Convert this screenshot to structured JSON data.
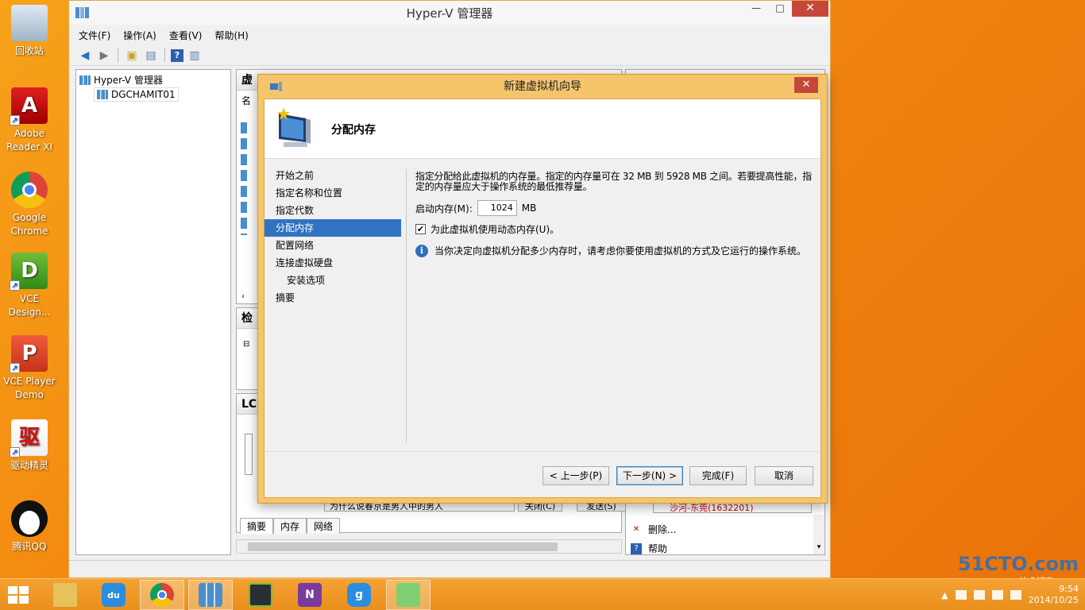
{
  "desktop": {
    "icons": [
      {
        "label": "回收站"
      },
      {
        "label": "Adobe Reader XI"
      },
      {
        "label": "Google Chrome"
      },
      {
        "label": "VCE Design..."
      },
      {
        "label": "VCE Player Demo"
      },
      {
        "label": "驱动精灵"
      },
      {
        "label": "腾讯QQ"
      }
    ]
  },
  "main_window": {
    "title": "Hyper-V 管理器",
    "controls": {
      "minimize": "—",
      "maximize": "□",
      "close": "✕"
    },
    "menu": [
      "文件(F)",
      "操作(A)",
      "查看(V)",
      "帮助(H)"
    ],
    "tree": {
      "root": "Hyper-V 管理器",
      "server": "DGCHAMIT01"
    },
    "center": {
      "vm_header": "虚",
      "name_col": "名",
      "checkpoint_header": "检",
      "details_header": "LC",
      "tabs": [
        "摘要",
        "内存",
        "网络"
      ]
    },
    "actions": {
      "header": "操",
      "delete": "删除...",
      "help": "帮助"
    },
    "background_text": {
      "chat_line": "为什么说春京是男人中的男人",
      "close_btn": "关闭(C)",
      "send_btn": "发送(S)",
      "contact": "沙河-东莞(1632201)"
    }
  },
  "wizard": {
    "title": "新建虚拟机向导",
    "close": "✕",
    "page_title": "分配内存",
    "steps": [
      {
        "label": "开始之前"
      },
      {
        "label": "指定名称和位置"
      },
      {
        "label": "指定代数"
      },
      {
        "label": "分配内存"
      },
      {
        "label": "配置网络"
      },
      {
        "label": "连接虚拟硬盘"
      },
      {
        "label": "安装选项"
      },
      {
        "label": "摘要"
      }
    ],
    "active_step": 3,
    "description_line1": "指定分配给此虚拟机的内存量。指定的内存量可在 32 MB 到 5928 MB 之间。若要提高性能，指",
    "description_line2": "定的内存量应大于操作系统的最低推荐量。",
    "startup_memory_label": "启动内存(M):",
    "startup_memory_value": "1024",
    "startup_memory_unit": "MB",
    "dynamic_memory_label": "为此虚拟机使用动态内存(U)。",
    "dynamic_memory_checked": true,
    "info_text": "当你决定向虚拟机分配多少内存时，请考虑你要使用虚拟机的方式及它运行的操作系统。",
    "buttons": {
      "prev": "< 上一步(P)",
      "next": "下一步(N) >",
      "finish": "完成(F)",
      "cancel": "取消"
    }
  },
  "taskbar": {
    "apps": [
      "file-explorer",
      "baidu-cloud",
      "chrome",
      "hyper-v-manager",
      "remote-desktop",
      "onenote",
      "app-7",
      "app-8"
    ],
    "clock_date": "2014/10/25",
    "clock_time": "9:54"
  },
  "watermark": {
    "site": "51CTO.com",
    "sub": "技术博客 Blog"
  },
  "colors": {
    "accent": "#3173c2",
    "desktop": "#f2860f",
    "dialog_frame": "#f4c56b",
    "close_red": "#c7463a"
  }
}
